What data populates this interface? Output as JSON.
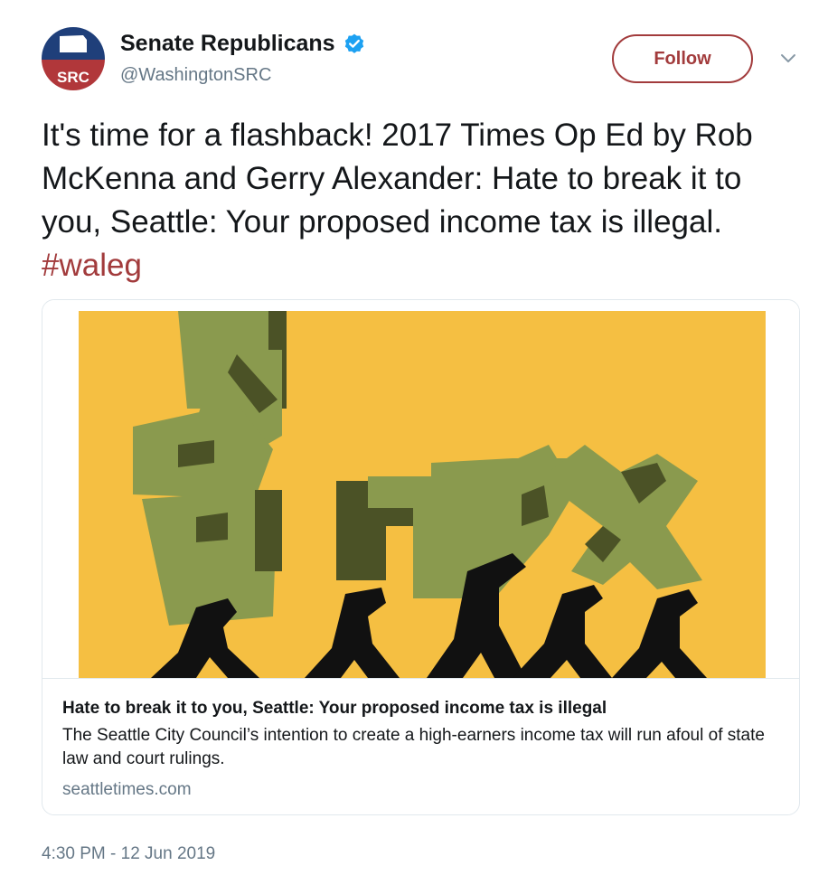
{
  "author": {
    "display_name": "Senate Republicans",
    "handle": "@WashingtonSRC",
    "avatar_text": "SRC",
    "verified": true
  },
  "follow_label": "Follow",
  "tweet": {
    "text": "It's time for a flashback! 2017 Times Op Ed by Rob McKenna and Gerry Alexander: Hate to break it to you, Seattle: Your proposed income tax is illegal.",
    "hashtag": "#waleg"
  },
  "card": {
    "title": "Hate to break it to you, Seattle: Your proposed income tax is illegal",
    "description": "The Seattle City Council’s intention to create a high-earners income tax will run afoul of state law and court rulings.",
    "domain": "seattletimes.com",
    "image_text": "TAX"
  },
  "timestamp": "4:30 PM - 12 Jun 2019",
  "colors": {
    "accent": "#a23b3c",
    "verified_blue": "#1da1f2",
    "image_background": "#f5bf42",
    "letter_green": "#8a9a4e",
    "letter_shadow": "#4b5226"
  },
  "icons": [
    "verified-badge-icon",
    "chevron-down-icon"
  ]
}
